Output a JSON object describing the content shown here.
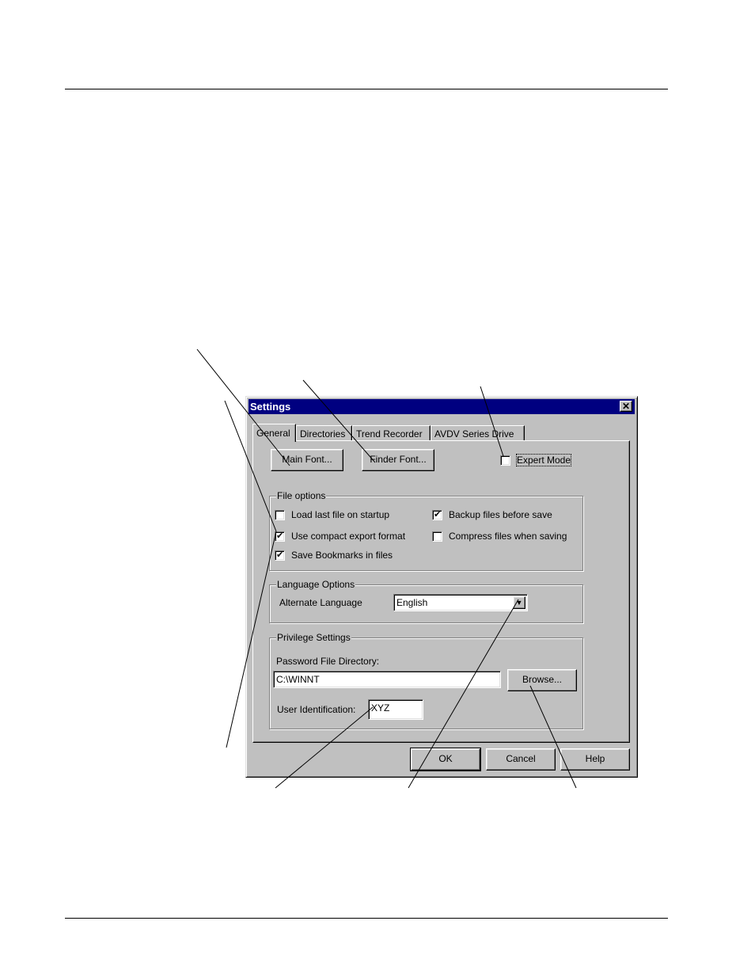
{
  "dialog": {
    "title": "Settings",
    "close_glyph": "✕",
    "tabs": [
      {
        "label": "General"
      },
      {
        "label": "Directories"
      },
      {
        "label": "Trend Recorder"
      },
      {
        "label": "AVDV Series Drive"
      }
    ],
    "buttons": {
      "main_font": "Main Font...",
      "finder_font": "Finder Font...",
      "browse": "Browse...",
      "ok": "OK",
      "cancel": "Cancel",
      "help": "Help"
    },
    "expert_mode": {
      "label": "Expert Mode",
      "checked": false
    },
    "file_options": {
      "title": "File options",
      "load_last": {
        "label": "Load last file on startup",
        "checked": false
      },
      "compact_export": {
        "label": "Use compact export format",
        "checked": true
      },
      "save_bookmarks": {
        "label": "Save Bookmarks in files",
        "checked": true
      },
      "backup": {
        "label": "Backup files before save",
        "checked": true
      },
      "compress": {
        "label": "Compress files when saving",
        "checked": false
      }
    },
    "language_options": {
      "title": "Language Options",
      "alt_language_label": "Alternate Language",
      "alt_language_value": "English"
    },
    "privilege_settings": {
      "title": "Privilege Settings",
      "password_dir_label": "Password File Directory:",
      "password_dir_value": "C:\\WINNT",
      "user_id_label": "User Identification:",
      "user_id_value": "XYZ"
    }
  }
}
